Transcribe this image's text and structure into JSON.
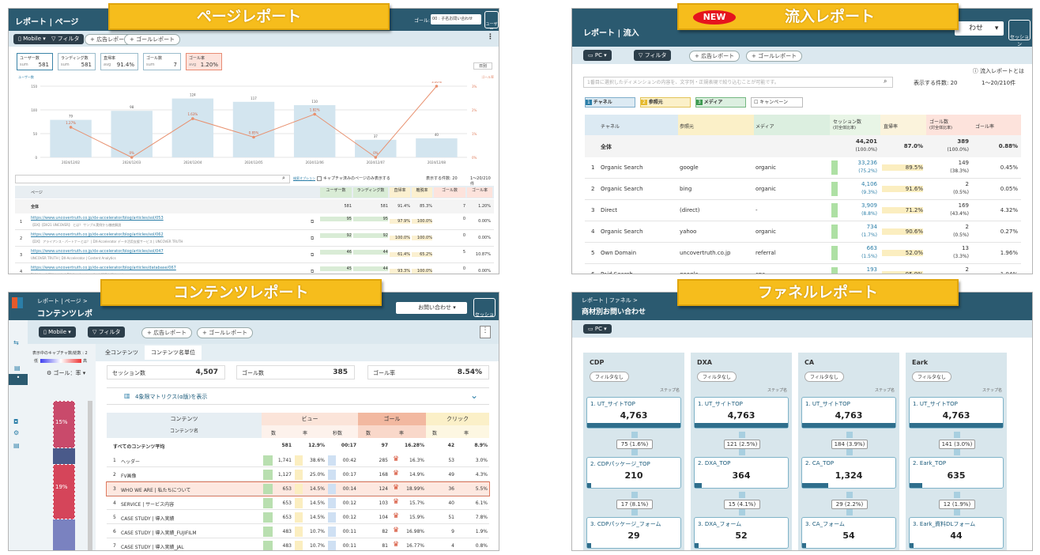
{
  "banners": {
    "page": "ページレポート",
    "inflow": "流入レポート",
    "content": "コンテンツレポート",
    "funnel": "ファネルレポート",
    "new_badge": "NEW"
  },
  "page_report": {
    "breadcrumb": "レポート | ページ",
    "device": "Mobile",
    "filter": "フィルタ",
    "ad_report": "+ 広告レポート",
    "goal_report": "+ ゴールレポート",
    "goal_label": "ゴール:",
    "goal_value": "00 : 子名お問い合わせ",
    "user_btn": "ユーザー",
    "metrics": [
      {
        "label": "ユーザー数",
        "prefix": "sum",
        "value": "581"
      },
      {
        "label": "ランディング数",
        "prefix": "sum",
        "value": "581"
      },
      {
        "label": "直帰率",
        "prefix": "avg",
        "value": "91.4%"
      },
      {
        "label": "ゴール数",
        "prefix": "sum",
        "value": "7"
      },
      {
        "label": "ゴール率",
        "prefix": "avg",
        "value": "1.20%"
      }
    ],
    "period": "日別",
    "y_left": "ユーザー数",
    "y_right": "ゴール率",
    "search_placeholder": "",
    "search_option": "検索オプション",
    "capture_only": "キャプチャ済みのページのみ表示する",
    "per_page": "表示する件数: 20",
    "range": "1〜20/210件",
    "table": {
      "headers": [
        "ページ",
        "ユーザー数",
        "ランディング数",
        "直帰率",
        "離脱率",
        "ゴール数",
        "ゴール率"
      ],
      "total": [
        "全体",
        "581",
        "581",
        "91.4%",
        "85.3%",
        "7",
        "1.20%"
      ],
      "rows": [
        {
          "n": "1",
          "url": "https://www.uncovertruth.co.jp/dx-accelerator/blog/articles/sol/053",
          "desc": "【DX】【DX21 UNCOVER】 とは？ サンプル実例から徹底解説",
          "users": "95",
          "land": "95",
          "bounce": "97.9%",
          "exit": "100.0%",
          "goal": "0",
          "rate": "0.00%"
        },
        {
          "n": "2",
          "url": "https://www.uncovertruth.co.jp/dx-accelerator/blog/articles/sol/062",
          "desc": "【DX】 アライアンス・パートナーとは？ | DX-Accelerator データ活用支援サービス | UNCOVER TRUTH",
          "users": "92",
          "land": "92",
          "bounce": "100.0%",
          "exit": "100.0%",
          "goal": "0",
          "rate": "0.00%"
        },
        {
          "n": "3",
          "url": "https://www.uncovertruth.co.jp/dx-accelerator/blog/articles/sol/047",
          "desc": "UNCOVER TRUTH | DX-Accelerator | Content Analytics",
          "users": "46",
          "land": "44",
          "bounce": "61.4%",
          "exit": "65.2%",
          "goal": "5",
          "rate": "10.87%"
        },
        {
          "n": "4",
          "url": "https://www.uncovertruth.co.jp/dx-accelerator/blog/articles/database/067",
          "desc": "DX推進の必要性とは？ | DX-Accelerator データ活用支援サービス",
          "users": "45",
          "land": "44",
          "bounce": "93.3%",
          "exit": "100.0%",
          "goal": "0",
          "rate": "0.00%"
        }
      ]
    },
    "chart_data": {
      "type": "bar",
      "categories": [
        "2024/12/02",
        "2024/12/03",
        "2024/12/04",
        "2024/12/05",
        "2024/12/06",
        "2024/12/07",
        "2024/12/08"
      ],
      "series": [
        {
          "name": "ユーザー数",
          "values": [
            79,
            98,
            124,
            117,
            110,
            37,
            40
          ]
        },
        {
          "name": "ゴール率",
          "values": [
            1.27,
            0,
            1.63,
            0.85,
            1.82,
            0,
            3.0
          ]
        }
      ],
      "ylim": [
        0,
        150
      ],
      "y2lim": [
        0,
        3
      ],
      "yticks": [
        "150",
        "100",
        "50",
        "0"
      ],
      "y2ticks": [
        "3%",
        "2%",
        "1%",
        "0%"
      ],
      "labels": [
        "79",
        "98",
        "124",
        "117",
        "110",
        "37",
        "40"
      ],
      "rate_labels": [
        "1.27%",
        "0%",
        "1.63%",
        "0.85%",
        "1.82%",
        "0%",
        "3.00%"
      ]
    }
  },
  "inflow_report": {
    "breadcrumb": "レポート | 流入",
    "device": "PC",
    "filter": "フィルタ",
    "ad_report": "+ 広告レポート",
    "goal_report": "+ ゴールレポート",
    "select_tail": "わせ",
    "user_btn": "セッション",
    "help": "流入レポートとは",
    "search_placeholder": "1番目に選択したディメンションの内容を、文字列・正規表現で絞り込むことが可能です。",
    "per_page": "表示する件数: 20",
    "range": "1〜20/210件",
    "chips": [
      {
        "n": "1",
        "label": "チャネル"
      },
      {
        "n": "2",
        "label": "参照元"
      },
      {
        "n": "3",
        "label": "メディア"
      }
    ],
    "campaign": "キャンペーン",
    "headers": [
      "チャネル",
      "参照元",
      "メディア",
      "セッション数",
      "直帰率",
      "ゴール数",
      "ゴール率"
    ],
    "subheaders": [
      "(対全体比率)",
      "(対全体比率)"
    ],
    "total": {
      "label": "全体",
      "sessions": "44,201",
      "sessions_pct": "(100.0%)",
      "bounce": "87.0%",
      "goals": "389",
      "goals_pct": "(100.0%)",
      "rate": "0.88%"
    },
    "rows": [
      {
        "n": "1",
        "channel": "Organic Search",
        "source": "google",
        "medium": "organic",
        "sessions": "33,236",
        "sp": "(75.2%)",
        "bounce": "89.5%",
        "goals": "149",
        "gp": "(38.3%)",
        "rate": "0.45%"
      },
      {
        "n": "2",
        "channel": "Organic Search",
        "source": "bing",
        "medium": "organic",
        "sessions": "4,106",
        "sp": "(9.3%)",
        "bounce": "91.6%",
        "goals": "2",
        "gp": "(0.5%)",
        "rate": "0.05%"
      },
      {
        "n": "3",
        "channel": "Direct",
        "source": "(direct)",
        "medium": "-",
        "sessions": "3,909",
        "sp": "(8.8%)",
        "bounce": "71.2%",
        "goals": "169",
        "gp": "(43.4%)",
        "rate": "4.32%"
      },
      {
        "n": "4",
        "channel": "Organic Search",
        "source": "yahoo",
        "medium": "organic",
        "sessions": "734",
        "sp": "(1.7%)",
        "bounce": "90.6%",
        "goals": "2",
        "gp": "(0.5%)",
        "rate": "0.27%"
      },
      {
        "n": "5",
        "channel": "Own Domain",
        "source": "uncovertruth.co.jp",
        "medium": "referral",
        "sessions": "663",
        "sp": "(1.5%)",
        "bounce": "52.0%",
        "goals": "13",
        "gp": "(3.3%)",
        "rate": "1.96%"
      },
      {
        "n": "6",
        "channel": "Paid Search",
        "source": "google",
        "medium": "cpc",
        "sessions": "193",
        "sp": "",
        "bounce": "95.9%",
        "goals": "2",
        "gp": "",
        "rate": "1.04%"
      }
    ]
  },
  "content_report": {
    "breadcrumb": "レポート | ページ >",
    "title": "コンテンツレポ",
    "select_value": "お問い合わせ",
    "user_btn": "セッション",
    "device": "Mobile",
    "filter": "フィルタ",
    "ad_report": "+ 広告レポート",
    "goal_report": "+ ゴールレポート",
    "tabs": [
      "全コンテンツ",
      "コンテンツ名単位"
    ],
    "capture_note": "表示中のキャプチャ数/総数 : 2",
    "legend_low": "低",
    "legend_high": "高",
    "goal_rate_sel": "ゴール：率",
    "heat_labels": [
      "15%",
      "19%"
    ],
    "kpis": [
      {
        "label": "セッション数",
        "value": "4,507"
      },
      {
        "label": "ゴール数",
        "value": "385"
      },
      {
        "label": "ゴール率",
        "value": "8.54%"
      }
    ],
    "matrix": "4象限マトリクス(α版)を表示",
    "groups": [
      "コンテンツ",
      "ビュー",
      "ゴール",
      "クリック"
    ],
    "subheaders": [
      "コンテンツ名",
      "数",
      "率",
      "秒数",
      "数",
      "率",
      "数",
      "率"
    ],
    "avg": [
      "すべてのコンテンツ平均",
      "581",
      "12.9%",
      "00:17",
      "97",
      "16.28%",
      "42",
      "8.9%"
    ],
    "rows": [
      {
        "n": "1",
        "name": "ヘッダー",
        "v": "1,741",
        "vr": "38.6%",
        "sec": "00:42",
        "g": "285",
        "gr": "16.3%",
        "c": "53",
        "cr": "3.0%"
      },
      {
        "n": "2",
        "name": "FV画像",
        "v": "1,127",
        "vr": "25.0%",
        "sec": "00:17",
        "g": "168",
        "gr": "14.9%",
        "c": "49",
        "cr": "4.3%"
      },
      {
        "n": "3",
        "name": "WHO WE ARE | 私たちについて",
        "v": "653",
        "vr": "14.5%",
        "sec": "00:14",
        "g": "124",
        "gr": "18.99%",
        "c": "36",
        "cr": "5.5%"
      },
      {
        "n": "4",
        "name": "SERVICE | サービス内容",
        "v": "653",
        "vr": "14.5%",
        "sec": "00:12",
        "g": "103",
        "gr": "15.7%",
        "c": "40",
        "cr": "6.1%"
      },
      {
        "n": "5",
        "name": "CASE STUDY | 導入実績",
        "v": "653",
        "vr": "14.5%",
        "sec": "00:12",
        "g": "104",
        "gr": "15.9%",
        "c": "51",
        "cr": "7.8%"
      },
      {
        "n": "6",
        "name": "CASE STUDY | 導入実績_FUJIFILM",
        "v": "483",
        "vr": "10.7%",
        "sec": "00:11",
        "g": "82",
        "gr": "16.98%",
        "c": "9",
        "cr": "1.9%"
      },
      {
        "n": "7",
        "name": "CASE STUDY | 導入実績_JAL",
        "v": "483",
        "vr": "10.7%",
        "sec": "00:11",
        "g": "81",
        "gr": "16.77%",
        "c": "4",
        "cr": "0.8%"
      }
    ]
  },
  "funnel_report": {
    "breadcrumb": "レポート | ファネル >",
    "title": "商材別お問い合わせ",
    "device": "PC",
    "no_filter": "フィルタなし",
    "step_name": "ステップ名",
    "columns": [
      {
        "name": "CDP",
        "steps": [
          {
            "label": "1. UT_サイトTOP",
            "value": "4,763"
          },
          {
            "label": "2. CDPパッケージ_TOP",
            "value": "210"
          },
          {
            "label": "3. CDPパッケージ_フォーム",
            "value": "29"
          }
        ],
        "rates": [
          "75 (1.6%)",
          "17 (8.1%)"
        ]
      },
      {
        "name": "DXA",
        "steps": [
          {
            "label": "1. UT_サイトTOP",
            "value": "4,763"
          },
          {
            "label": "2. DXA_TOP",
            "value": "364"
          },
          {
            "label": "3. DXA_フォーム",
            "value": "52"
          }
        ],
        "rates": [
          "121 (2.5%)",
          "15 (4.1%)"
        ]
      },
      {
        "name": "CA",
        "steps": [
          {
            "label": "1. UT_サイトTOP",
            "value": "4,763"
          },
          {
            "label": "2. CA_TOP",
            "value": "1,324"
          },
          {
            "label": "3. CA_フォーム",
            "value": "54"
          }
        ],
        "rates": [
          "184 (3.9%)",
          "29 (2.2%)"
        ]
      },
      {
        "name": "Eark",
        "steps": [
          {
            "label": "1. UT_サイトTOP",
            "value": "4,763"
          },
          {
            "label": "2. Eark_TOP",
            "value": "635"
          },
          {
            "label": "3. Eark_資料DLフォーム",
            "value": "44"
          }
        ],
        "rates": [
          "141 (3.0%)",
          "12 (1.9%)"
        ]
      }
    ]
  }
}
